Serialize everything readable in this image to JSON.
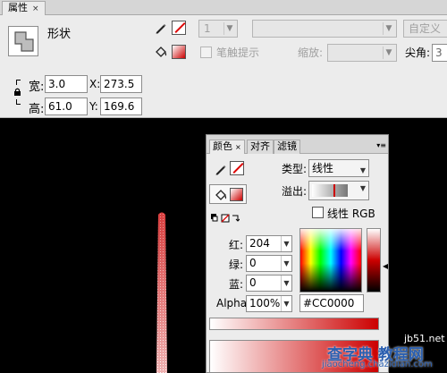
{
  "props_panel": {
    "tab_label": "属性",
    "close_glyph": "×",
    "shape_label": "形状",
    "stroke_size": "1",
    "custom_button": "自定义",
    "hint_label": "笔触提示",
    "scale_label": "缩放:",
    "corner_label": "尖角:",
    "corner_value": "3",
    "width_label": "宽:",
    "width_value": "3.0",
    "x_label": "X:",
    "x_value": "273.5",
    "height_label": "高:",
    "height_value": "61.0",
    "y_label": "Y:",
    "y_value": "169.6"
  },
  "color_panel": {
    "tabs": [
      {
        "label": "颜色",
        "close": "×"
      },
      {
        "label": "对齐"
      },
      {
        "label": "滤镜"
      }
    ],
    "type_label": "类型:",
    "type_value": "线性",
    "overflow_label": "溢出:",
    "linear_rgb_label": "线性 RGB",
    "red_label": "红:",
    "red_value": "204",
    "green_label": "绿:",
    "green_value": "0",
    "blue_label": "蓝:",
    "blue_value": "0",
    "alpha_label": "Alpha:",
    "alpha_value": "100%",
    "hex_value": "#CC0000",
    "fill_color": "#CC0000"
  },
  "icons": {
    "stroke_pencil": "pencil-icon",
    "fill_bucket": "paint-bucket-icon",
    "lock": "lock-icon"
  },
  "watermark": {
    "main": "查字典 教程网",
    "sub": "jiaocheng.chazidian.com",
    "site": "jb51.net"
  }
}
